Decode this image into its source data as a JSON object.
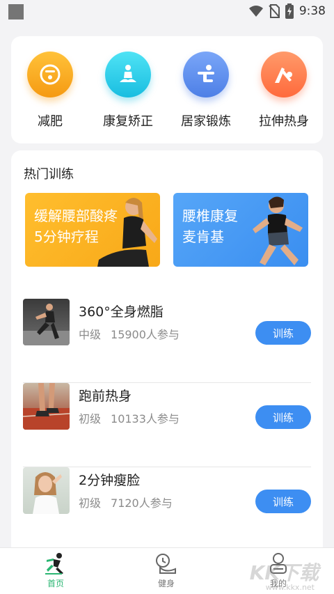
{
  "status_bar": {
    "time": "9:38"
  },
  "categories": [
    {
      "label": "减肥",
      "icon": "scale-icon",
      "color": "#f9a51a"
    },
    {
      "label": "康复矫正",
      "icon": "meditation-icon",
      "color": "#2ed0e8"
    },
    {
      "label": "居家锻炼",
      "icon": "exercise-icon",
      "color": "#5c8ff0"
    },
    {
      "label": "拉伸热身",
      "icon": "stretch-icon",
      "color": "#ff7a4a"
    }
  ],
  "hot_training": {
    "title": "热门训练",
    "banners": [
      {
        "line1": "缓解腰部酸疼",
        "line2": "5分钟疗程",
        "color": "#fbb21e"
      },
      {
        "line1": "腰椎康复",
        "line2": "麦肯基",
        "color": "#4a9af4"
      }
    ],
    "items": [
      {
        "title": "360°全身燃脂",
        "level": "中级",
        "participants": "15900人参与",
        "button": "训练"
      },
      {
        "title": "跑前热身",
        "level": "初级",
        "participants": "10133人参与",
        "button": "训练"
      },
      {
        "title": "2分钟瘦脸",
        "level": "初级",
        "participants": "7120人参与",
        "button": "训练"
      }
    ]
  },
  "bottom_nav": [
    {
      "label": "首页",
      "icon": "runner-icon",
      "active": true
    },
    {
      "label": "健身",
      "icon": "fitness-icon",
      "active": false
    },
    {
      "label": "我的",
      "icon": "profile-icon",
      "active": false
    }
  ],
  "watermark": {
    "text": "KK下载",
    "url": "www.kkx.net"
  },
  "colors": {
    "accent": "#3d8ef2",
    "active_nav": "#2bb673"
  }
}
